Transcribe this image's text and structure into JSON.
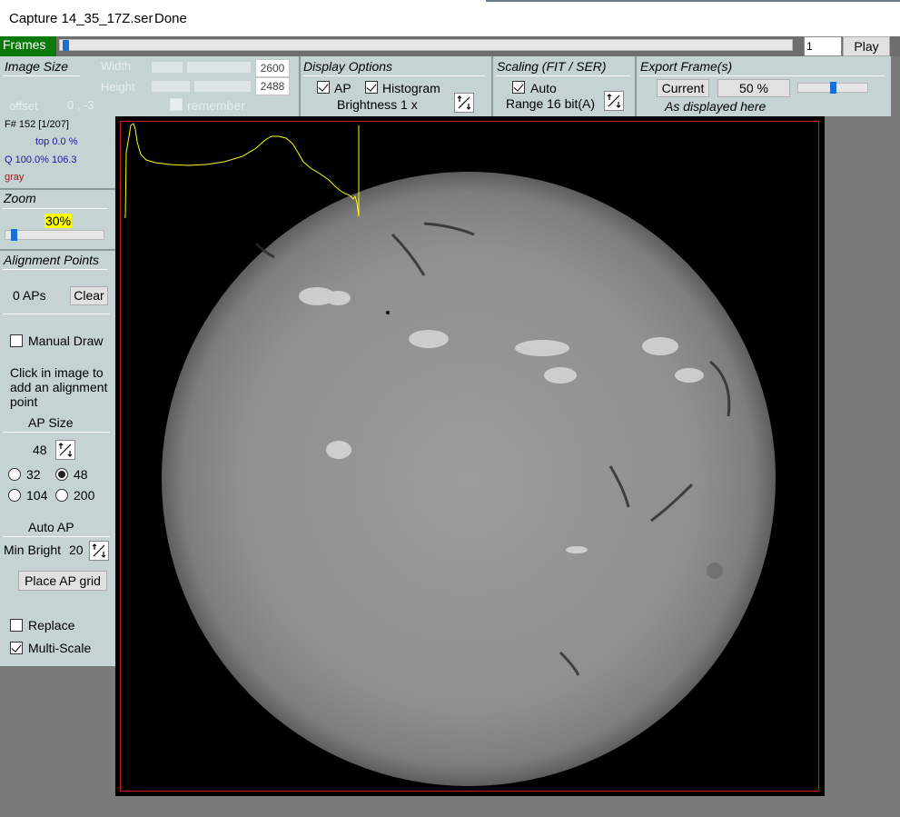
{
  "window": {
    "title": "Capture 14_35_17Z.ser",
    "status": "Done"
  },
  "frames": {
    "label": "Frames",
    "current": "1",
    "play_label": "Play",
    "position_fraction": 0.0
  },
  "image_size": {
    "title": "Image Size",
    "width_label": "Width",
    "height_label": "Height",
    "width_value": "2600",
    "height_value": "2488",
    "remember_label": "remember",
    "offset_label": "offset",
    "offset_value": "0 , -3"
  },
  "display_options": {
    "title": "Display Options",
    "ap_label": "AP",
    "histogram_label": "Histogram",
    "brightness_label": "Brightness 1 x"
  },
  "scaling": {
    "title": "Scaling (FIT / SER)",
    "auto_label": "Auto",
    "range_label": "Range 16 bit(A)"
  },
  "export": {
    "title": "Export Frame(s)",
    "current_label": "Current",
    "percent_label": "50 %",
    "note": "As displayed here",
    "slider_fraction": 0.5
  },
  "info": {
    "frame": "F# 152 [1/207]",
    "top": "top 0.0 %",
    "quality": "Q 100.0%  106.3",
    "color_mode": "gray"
  },
  "zoom": {
    "title": "Zoom",
    "value": "30%",
    "slider_fraction": 0.0
  },
  "alignment": {
    "title": "Alignment Points",
    "count": "0 APs",
    "clear_label": "Clear",
    "manual_draw_label": "Manual Draw",
    "instruction": "Click in image to add an alignment point",
    "ap_size_title": "AP Size",
    "ap_size_value": "48",
    "sizes": [
      "32",
      "48",
      "104",
      "200"
    ],
    "selected_size": "48",
    "auto_ap_title": "Auto AP",
    "min_bright_label": "Min Bright",
    "min_bright_value": "20",
    "place_grid_label": "Place AP grid",
    "replace_label": "Replace",
    "multiscale_label": "Multi-Scale"
  },
  "colors": {
    "frames_green": "#0b7a0b",
    "panel_bg": "#c6d3d3",
    "histogram": "#ffff00",
    "border_red": "#c81a1a",
    "zoom_highlight": "#ffff00"
  }
}
